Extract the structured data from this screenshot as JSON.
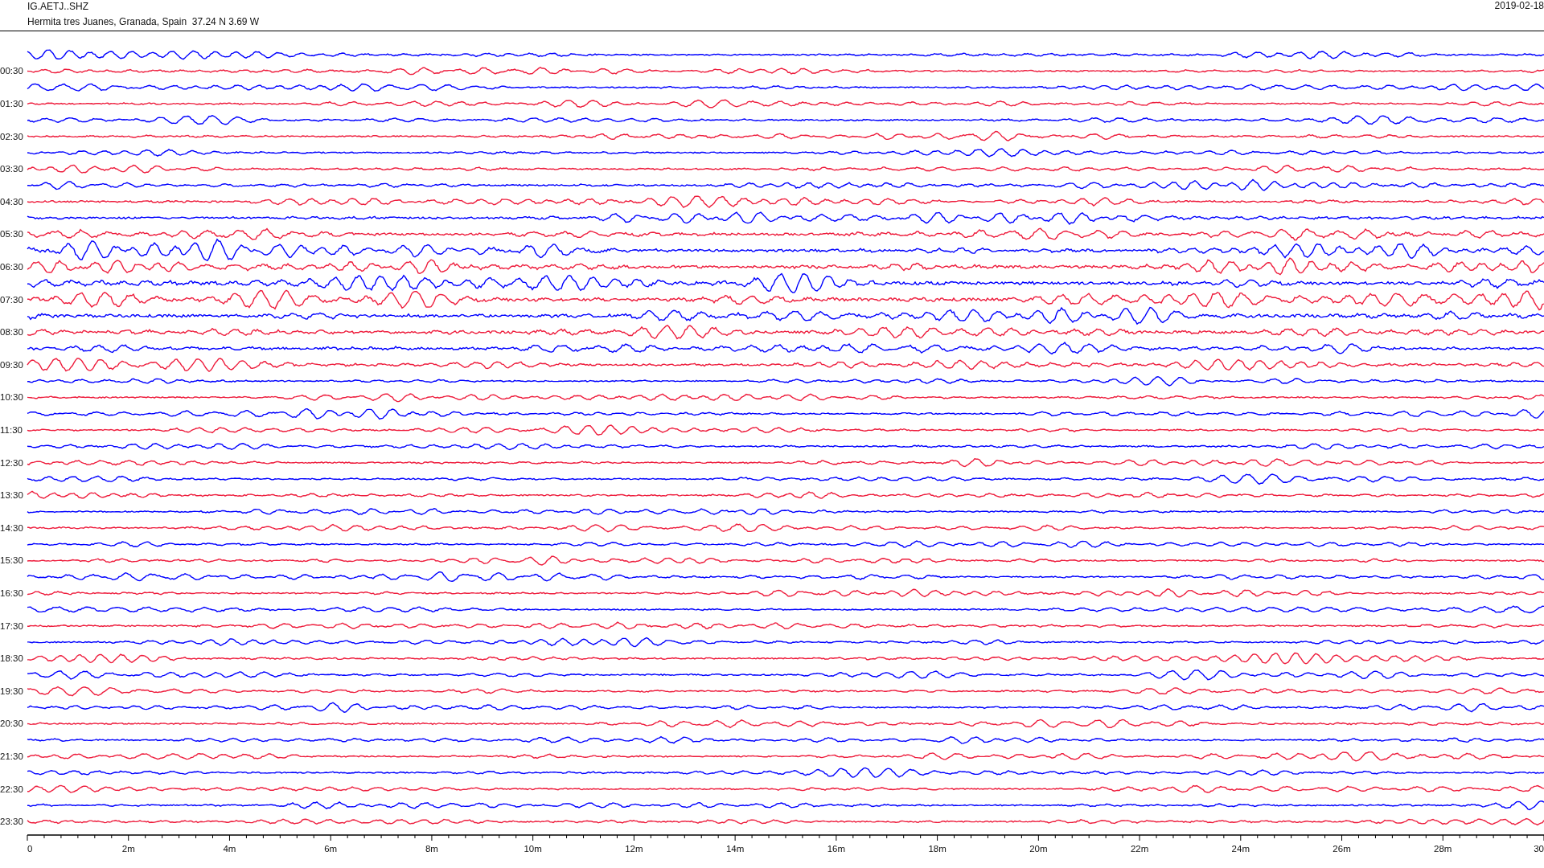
{
  "header": {
    "station": "IG.AETJ..SHZ",
    "location": "Hermita tres Juanes, Granada, Spain  37.24 N 3.69 W",
    "date": "2019-02-18"
  },
  "traces": [
    {
      "color": "#0000ff"
    },
    {
      "label": "00:30",
      "color": "#ee1c3c"
    },
    {
      "color": "#0000ff"
    },
    {
      "label": "01:30",
      "color": "#ee1c3c"
    },
    {
      "color": "#0000ff"
    },
    {
      "label": "02:30",
      "color": "#ee1c3c"
    },
    {
      "color": "#0000ff"
    },
    {
      "label": "03:30",
      "color": "#ee1c3c"
    },
    {
      "color": "#0000ff"
    },
    {
      "label": "04:30",
      "color": "#ee1c3c"
    },
    {
      "color": "#0000ff"
    },
    {
      "label": "05:30",
      "color": "#ee1c3c"
    },
    {
      "color": "#0000ff"
    },
    {
      "label": "06:30",
      "color": "#ee1c3c"
    },
    {
      "color": "#0000ff"
    },
    {
      "label": "07:30",
      "color": "#ee1c3c"
    },
    {
      "color": "#0000ff"
    },
    {
      "label": "08:30",
      "color": "#ee1c3c"
    },
    {
      "color": "#0000ff"
    },
    {
      "label": "09:30",
      "color": "#ee1c3c"
    },
    {
      "color": "#0000ff"
    },
    {
      "label": "10:30",
      "color": "#ee1c3c"
    },
    {
      "color": "#0000ff"
    },
    {
      "label": "11:30",
      "color": "#ee1c3c"
    },
    {
      "color": "#0000ff"
    },
    {
      "label": "12:30",
      "color": "#ee1c3c"
    },
    {
      "color": "#0000ff"
    },
    {
      "label": "13:30",
      "color": "#ee1c3c"
    },
    {
      "color": "#0000ff"
    },
    {
      "label": "14:30",
      "color": "#ee1c3c"
    },
    {
      "color": "#0000ff"
    },
    {
      "label": "15:30",
      "color": "#ee1c3c"
    },
    {
      "color": "#0000ff"
    },
    {
      "label": "16:30",
      "color": "#ee1c3c"
    },
    {
      "color": "#0000ff"
    },
    {
      "label": "17:30",
      "color": "#ee1c3c"
    },
    {
      "color": "#0000ff"
    },
    {
      "label": "18:30",
      "color": "#ee1c3c"
    },
    {
      "color": "#0000ff"
    },
    {
      "label": "19:30",
      "color": "#ee1c3c"
    },
    {
      "color": "#0000ff"
    },
    {
      "label": "20:30",
      "color": "#ee1c3c"
    },
    {
      "color": "#0000ff"
    },
    {
      "label": "21:30",
      "color": "#ee1c3c"
    },
    {
      "color": "#0000ff"
    },
    {
      "label": "22:30",
      "color": "#ee1c3c"
    },
    {
      "color": "#0000ff"
    },
    {
      "label": "23:30",
      "color": "#ee1c3c"
    }
  ],
  "time_axis": {
    "ticks": [
      "0",
      "2m",
      "4m",
      "6m",
      "8m",
      "10m",
      "12m",
      "14m",
      "16m",
      "18m",
      "20m",
      "22m",
      "24m",
      "26m",
      "28m",
      "30"
    ]
  }
}
